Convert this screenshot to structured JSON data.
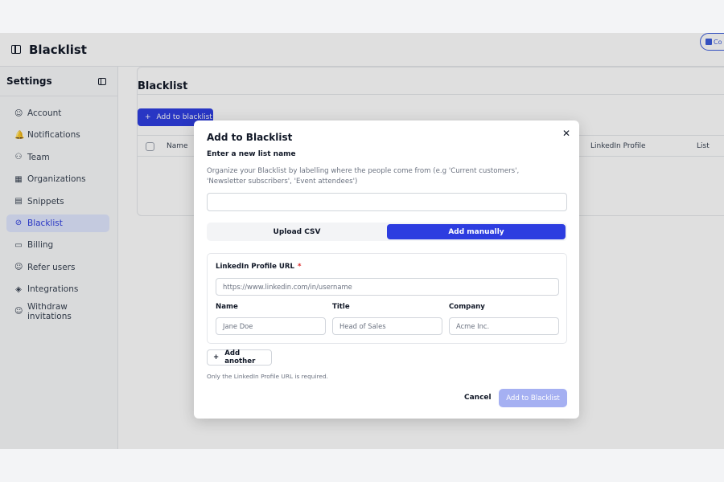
{
  "header": {
    "title": "Blacklist",
    "corner_chip": "Co"
  },
  "sidebar": {
    "title": "Settings",
    "items": [
      {
        "label": "Account",
        "icon": "user-icon",
        "glyph": "☺"
      },
      {
        "label": "Notifications",
        "icon": "bell-icon",
        "glyph": "🔔"
      },
      {
        "label": "Team",
        "icon": "users-icon",
        "glyph": "⚇"
      },
      {
        "label": "Organizations",
        "icon": "building-icon",
        "glyph": "▦"
      },
      {
        "label": "Snippets",
        "icon": "document-icon",
        "glyph": "▤"
      },
      {
        "label": "Blacklist",
        "icon": "ban-icon",
        "glyph": "⊘",
        "active": true
      },
      {
        "label": "Billing",
        "icon": "credit-card-icon",
        "glyph": "▭"
      },
      {
        "label": "Refer users",
        "icon": "user-plus-icon",
        "glyph": "☺"
      },
      {
        "label": "Integrations",
        "icon": "puzzle-icon",
        "glyph": "◈"
      },
      {
        "label": "Withdraw invitations",
        "icon": "user-minus-icon",
        "glyph": "☺"
      }
    ]
  },
  "main": {
    "title": "Blacklist",
    "add_button": "Add to blacklist",
    "table_headers": {
      "name": "Name",
      "linkedin": "LinkedIn Profile",
      "list": "List"
    }
  },
  "modal": {
    "title": "Add to Blacklist",
    "list_name_label": "Enter a new list name",
    "list_name_help": "Organize your Blacklist by labelling where the people come from (e.g 'Current customers', 'Newsletter subscribers', 'Event attendees')",
    "list_name_value": "",
    "tabs": {
      "upload": "Upload CSV",
      "manual": "Add manually",
      "active": "manual"
    },
    "form": {
      "linkedin_label": "LinkedIn Profile URL",
      "required_mark": "*",
      "linkedin_placeholder": "https://www.linkedin.com/in/username",
      "name_label": "Name",
      "name_placeholder": "Jane Doe",
      "title_label": "Title",
      "title_placeholder": "Head of Sales",
      "company_label": "Company",
      "company_placeholder": "Acme Inc."
    },
    "add_another": "Add another",
    "note": "Only the LinkedIn Profile URL is required.",
    "cancel": "Cancel",
    "submit": "Add to Blacklist"
  },
  "colors": {
    "accent": "#2d3de0",
    "accent_disabled": "#a5b0f2",
    "active_bg": "#e0e7ff",
    "required": "#dc2626"
  }
}
